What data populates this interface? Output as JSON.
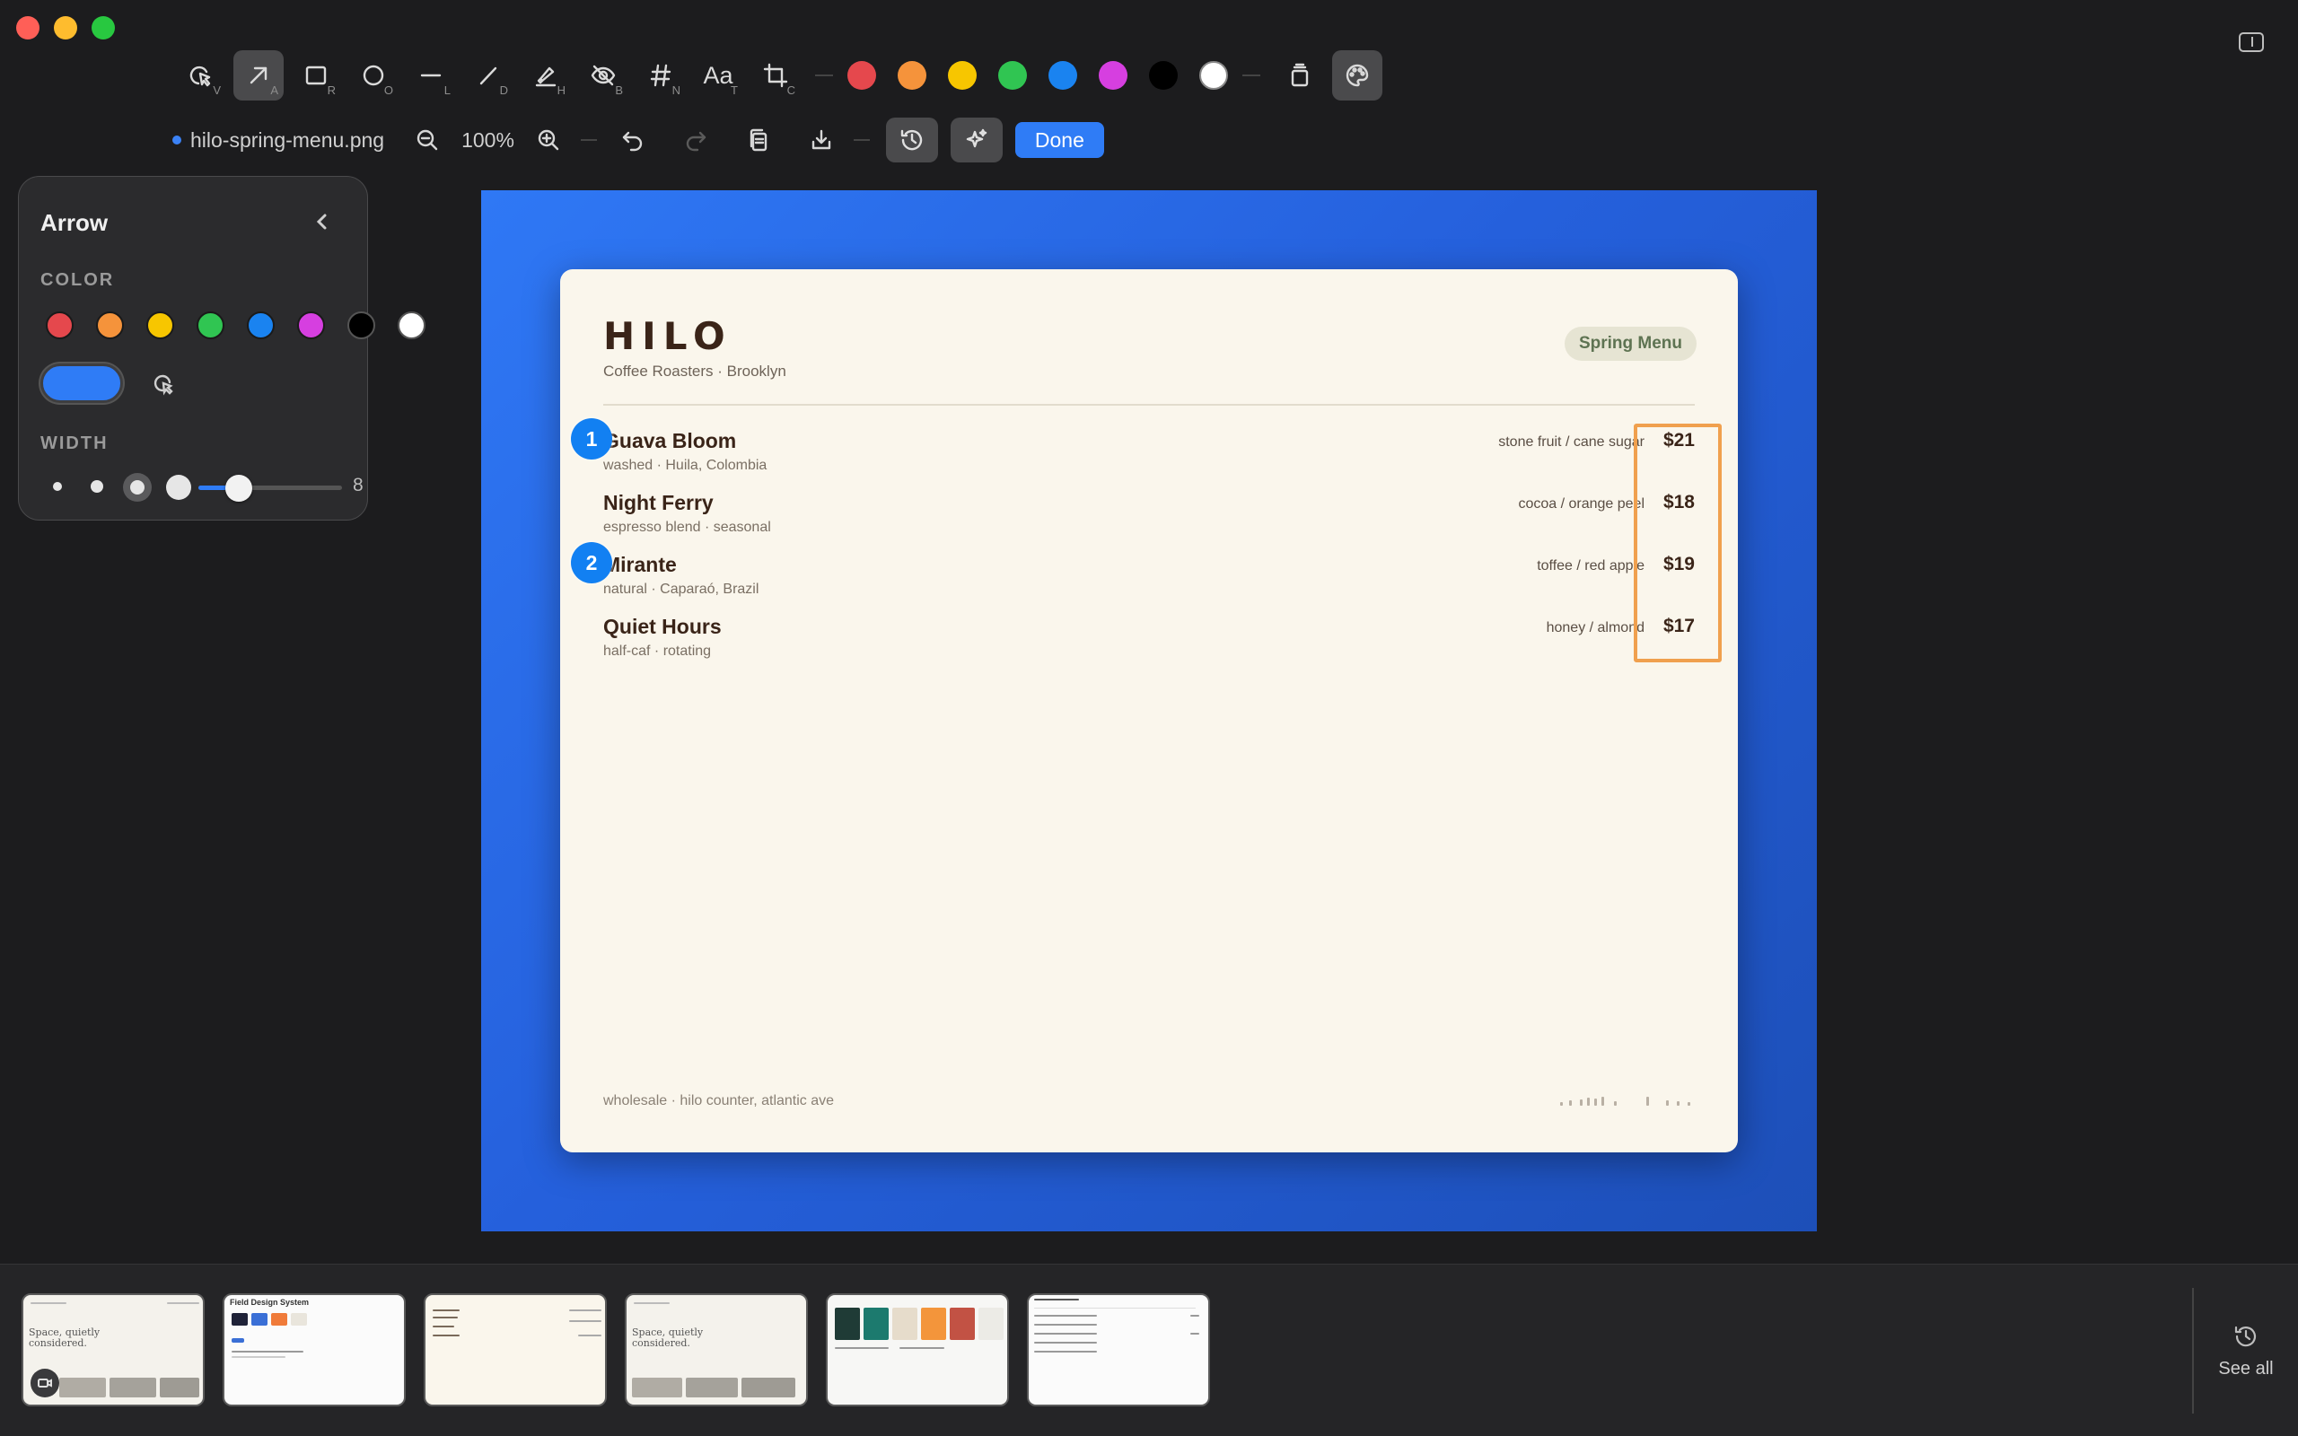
{
  "window": {
    "colors": {
      "close": "#ff5f57",
      "minimize": "#febc2e",
      "zoom": "#28c840"
    }
  },
  "toolbar": {
    "tools": [
      {
        "id": "select",
        "icon": "cursor-icon",
        "key": "V",
        "active": false
      },
      {
        "id": "arrow",
        "icon": "arrow-icon",
        "key": "A",
        "active": true
      },
      {
        "id": "rectangle",
        "icon": "rectangle-icon",
        "key": "R",
        "active": false
      },
      {
        "id": "ellipse",
        "icon": "ellipse-icon",
        "key": "O",
        "active": false
      },
      {
        "id": "line",
        "icon": "line-icon",
        "key": "L",
        "active": false
      },
      {
        "id": "draw",
        "icon": "pen-icon",
        "key": "D",
        "active": false
      },
      {
        "id": "highlighter",
        "icon": "highlighter-icon",
        "key": "H",
        "active": false
      },
      {
        "id": "blur",
        "icon": "eye-slash-icon",
        "key": "B",
        "active": false
      },
      {
        "id": "number",
        "icon": "hash-icon",
        "key": "N",
        "active": false
      },
      {
        "id": "text",
        "icon": "text-icon",
        "label": "Aa",
        "key": "T",
        "active": false
      },
      {
        "id": "crop",
        "icon": "crop-icon",
        "key": "C",
        "active": false
      }
    ],
    "colors": [
      "#e5484d",
      "#f5933b",
      "#f7c600",
      "#30c552",
      "#1a83f0",
      "#d63fe0",
      "#000000",
      "#ffffff"
    ],
    "file_name": "hilo-spring-menu.png",
    "zoom": "100%",
    "done_label": "Done"
  },
  "arrow_panel": {
    "title": "Arrow",
    "color_label": "COLOR",
    "width_label": "WIDTH",
    "colors": [
      "#e5484d",
      "#f5933b",
      "#f7c600",
      "#30c552",
      "#1a83f0",
      "#d63fe0",
      "#000000",
      "#ffffff"
    ],
    "selected_color": "#2f7cf6",
    "width_value": "8",
    "width_fraction": 0.28
  },
  "menu_card": {
    "brand": "HILO",
    "subtitle": "Coffee Roasters · Brooklyn",
    "badge": "Spring Menu",
    "items": [
      {
        "name": "Guava Bloom",
        "sub": "washed · Huila, Colombia",
        "notes": "stone fruit / cane sugar",
        "price": "$21"
      },
      {
        "name": "Night Ferry",
        "sub": "espresso blend · seasonal",
        "notes": "cocoa / orange peel",
        "price": "$18"
      },
      {
        "name": "Mirante",
        "sub": "natural · Caparaó, Brazil",
        "notes": "toffee / red apple",
        "price": "$19"
      },
      {
        "name": "Quiet Hours",
        "sub": "half-caf · rotating",
        "notes": "honey / almond",
        "price": "$17"
      }
    ],
    "footer": "wholesale · hilo counter, atlantic ave"
  },
  "annotations": {
    "markers": [
      "1",
      "2"
    ],
    "marker_color": "#1280f2",
    "rect_color": "#f0a04e"
  },
  "history": {
    "thumbnails": [
      {
        "caption": "Space, quietly considered."
      },
      {
        "caption": "Field Design System"
      },
      {
        "caption": ""
      },
      {
        "caption": "Space, quietly considered."
      },
      {
        "caption": ""
      },
      {
        "caption": ""
      }
    ],
    "see_all_label": "See all"
  }
}
